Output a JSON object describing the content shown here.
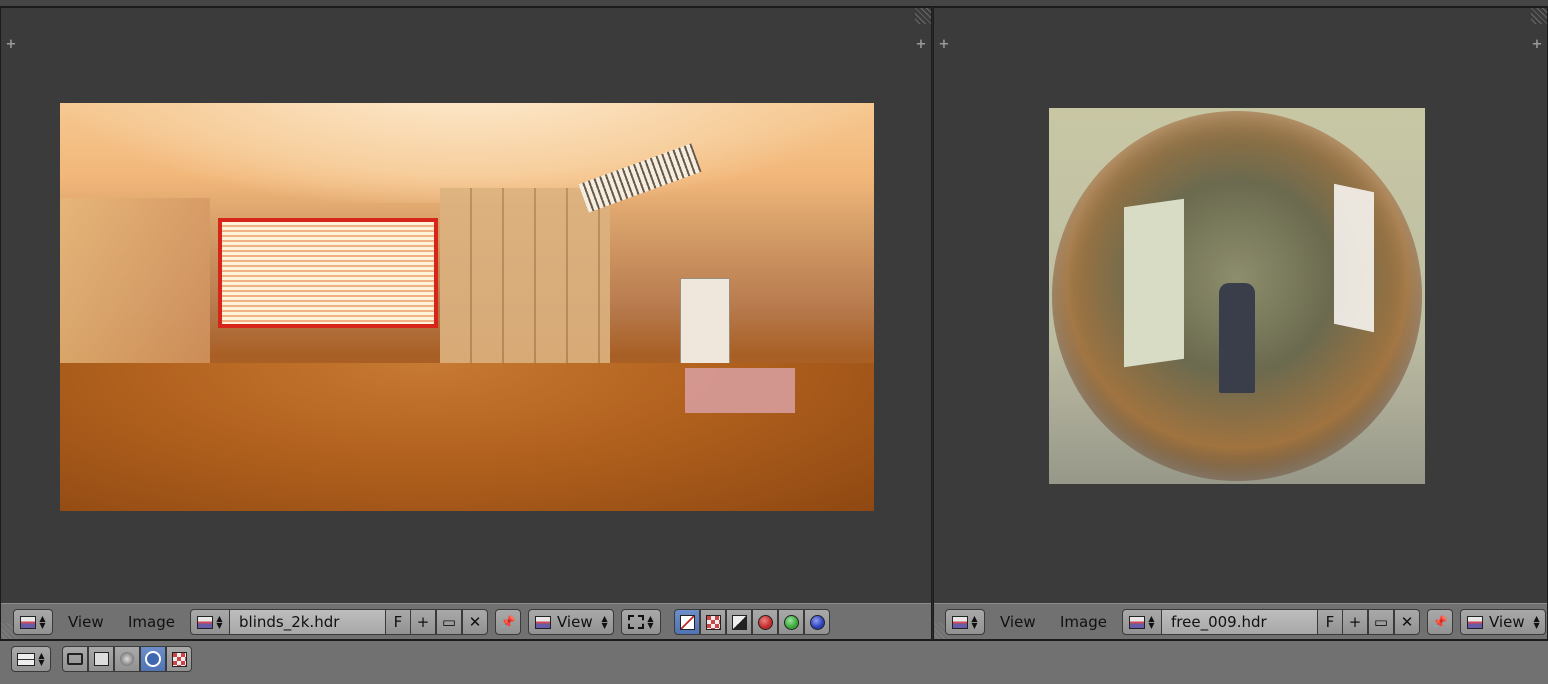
{
  "left_editor": {
    "header": {
      "view_menu": "View",
      "image_menu": "Image",
      "image_name": "blinds_2k.hdr",
      "fake_user": "F",
      "view_dropdown": "View"
    }
  },
  "right_editor": {
    "header": {
      "view_menu": "View",
      "image_menu": "Image",
      "image_name": "free_009.hdr",
      "fake_user": "F",
      "view_dropdown": "View"
    }
  },
  "glyphs": {
    "plus": "+",
    "new": "+",
    "open": "▭",
    "unlink": "✕",
    "pin": "📌"
  },
  "colors": {
    "channel_red": "#c12b2b",
    "channel_green": "#3aa63a",
    "channel_blue": "#2b3fb8",
    "selected": "#5a7fc0"
  }
}
